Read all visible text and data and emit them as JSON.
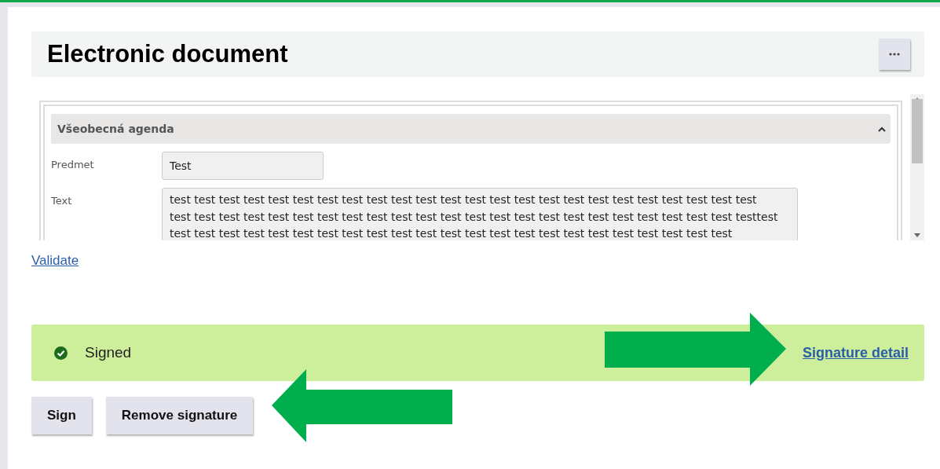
{
  "header": {
    "title": "Electronic document"
  },
  "form": {
    "section": {
      "title": "Všeobecná agenda",
      "expanded": true
    },
    "subject": {
      "label": "Predmet",
      "value": "Test"
    },
    "text": {
      "label": "Text",
      "lines": [
        "test test test test test test test test test test test test test test test test test test test test test test test test",
        "test test test test test test test test test test test test test test test test test test test test test test test testtest",
        "test test test test test test test test test test test test test test test test test test test test test test test"
      ]
    }
  },
  "validate_link": "Validate",
  "status": {
    "signed": true,
    "text": "Signed",
    "detail_link": "Signature detail"
  },
  "buttons": [
    "Sign",
    "Remove signature"
  ]
}
